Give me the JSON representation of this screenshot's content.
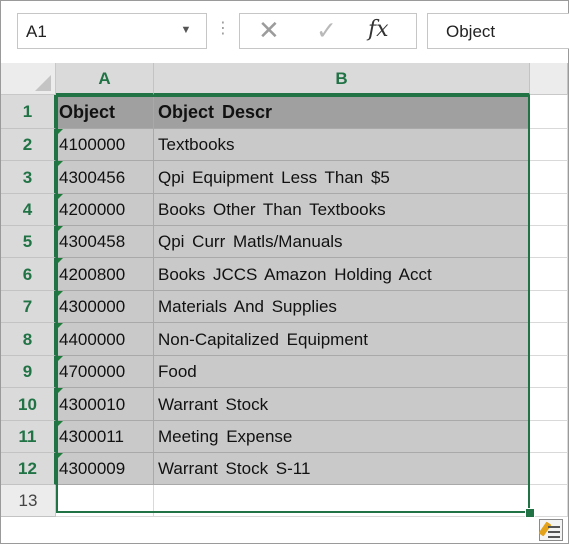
{
  "formula_bar": {
    "name_box": "A1",
    "name_box_arrow": "▼",
    "separator": "⋮",
    "cancel_symbol": "✕",
    "enter_symbol": "✓",
    "fx_symbol": "fx",
    "formula_value": "Object"
  },
  "columns": [
    "A",
    "B"
  ],
  "rows": [
    {
      "num": "1",
      "a": "Object",
      "b": "Object Descr"
    },
    {
      "num": "2",
      "a": "4100000",
      "b": "Textbooks"
    },
    {
      "num": "3",
      "a": "4300456",
      "b": "Qpi Equipment Less Than $5"
    },
    {
      "num": "4",
      "a": "4200000",
      "b": "Books Other Than Textbooks"
    },
    {
      "num": "5",
      "a": "4300458",
      "b": "Qpi Curr Matls/Manuals"
    },
    {
      "num": "6",
      "a": "4200800",
      "b": "Books JCCS Amazon Holding Acct"
    },
    {
      "num": "7",
      "a": "4300000",
      "b": "Materials And Supplies"
    },
    {
      "num": "8",
      "a": "4400000",
      "b": "Non-Capitalized Equipment"
    },
    {
      "num": "9",
      "a": "4700000",
      "b": "Food"
    },
    {
      "num": "10",
      "a": "4300010",
      "b": "Warrant Stock"
    },
    {
      "num": "11",
      "a": "4300011",
      "b": "Meeting Expense"
    },
    {
      "num": "12",
      "a": "4300009",
      "b": "Warrant Stock S-11"
    },
    {
      "num": "13",
      "a": "",
      "b": ""
    }
  ],
  "colors": {
    "accent": "#217346",
    "selection_fill": "#c9c9c9",
    "header_fill": "#a0a0a0",
    "error_indicator": "#1e7b3c"
  },
  "icons": {
    "quick_analysis": "quick-analysis-icon"
  }
}
